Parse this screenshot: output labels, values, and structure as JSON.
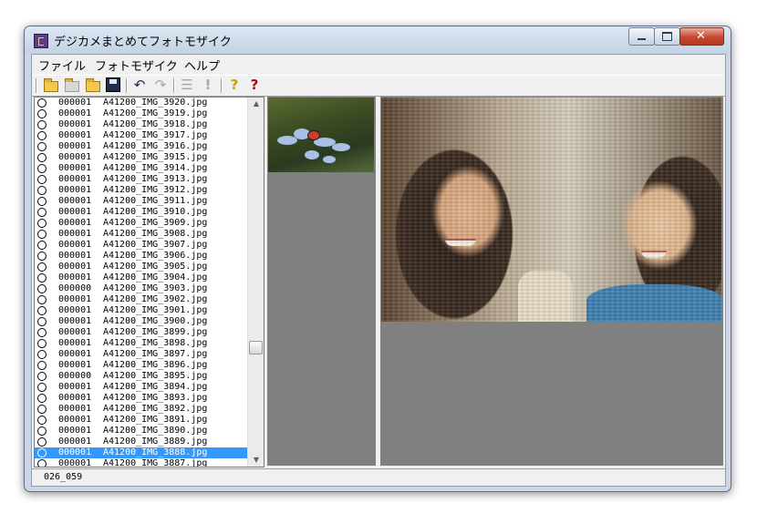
{
  "window": {
    "title": "デジカメまとめてフォトモザイク",
    "controls": [
      "minimize",
      "maximize",
      "close"
    ]
  },
  "menu": [
    {
      "label": "ファイル"
    },
    {
      "label": "フォトモザイク"
    },
    {
      "label": "ヘルプ"
    }
  ],
  "toolbar": {
    "icons": [
      "open-folder-icon",
      "import-icon",
      "folder-icon",
      "save-disk-icon",
      "undo-icon",
      "redo-icon",
      "list-icon",
      "exclamation-icon",
      "help-icon",
      "context-help-icon"
    ]
  },
  "file_list": {
    "rows": [
      {
        "count": "000001",
        "name": "A41200_IMG_3920.jpg"
      },
      {
        "count": "000001",
        "name": "A41200_IMG_3919.jpg"
      },
      {
        "count": "000001",
        "name": "A41200_IMG_3918.jpg"
      },
      {
        "count": "000001",
        "name": "A41200_IMG_3917.jpg"
      },
      {
        "count": "000001",
        "name": "A41200_IMG_3916.jpg"
      },
      {
        "count": "000001",
        "name": "A41200_IMG_3915.jpg"
      },
      {
        "count": "000001",
        "name": "A41200_IMG_3914.jpg"
      },
      {
        "count": "000001",
        "name": "A41200_IMG_3913.jpg"
      },
      {
        "count": "000001",
        "name": "A41200_IMG_3912.jpg"
      },
      {
        "count": "000001",
        "name": "A41200_IMG_3911.jpg"
      },
      {
        "count": "000001",
        "name": "A41200_IMG_3910.jpg"
      },
      {
        "count": "000001",
        "name": "A41200_IMG_3909.jpg"
      },
      {
        "count": "000001",
        "name": "A41200_IMG_3908.jpg"
      },
      {
        "count": "000001",
        "name": "A41200_IMG_3907.jpg"
      },
      {
        "count": "000001",
        "name": "A41200_IMG_3906.jpg"
      },
      {
        "count": "000001",
        "name": "A41200_IMG_3905.jpg"
      },
      {
        "count": "000001",
        "name": "A41200_IMG_3904.jpg"
      },
      {
        "count": "000000",
        "name": "A41200_IMG_3903.jpg"
      },
      {
        "count": "000001",
        "name": "A41200_IMG_3902.jpg"
      },
      {
        "count": "000001",
        "name": "A41200_IMG_3901.jpg"
      },
      {
        "count": "000001",
        "name": "A41200_IMG_3900.jpg"
      },
      {
        "count": "000001",
        "name": "A41200_IMG_3899.jpg"
      },
      {
        "count": "000001",
        "name": "A41200_IMG_3898.jpg"
      },
      {
        "count": "000001",
        "name": "A41200_IMG_3897.jpg"
      },
      {
        "count": "000001",
        "name": "A41200_IMG_3896.jpg"
      },
      {
        "count": "000000",
        "name": "A41200_IMG_3895.jpg"
      },
      {
        "count": "000001",
        "name": "A41200_IMG_3894.jpg"
      },
      {
        "count": "000001",
        "name": "A41200_IMG_3893.jpg"
      },
      {
        "count": "000001",
        "name": "A41200_IMG_3892.jpg"
      },
      {
        "count": "000001",
        "name": "A41200_IMG_3891.jpg"
      },
      {
        "count": "000001",
        "name": "A41200_IMG_3890.jpg"
      },
      {
        "count": "000001",
        "name": "A41200_IMG_3889.jpg"
      },
      {
        "count": "000001",
        "name": "A41200_IMG_3888.jpg",
        "selected": true
      },
      {
        "count": "000001",
        "name": "A41200_IMG_3887.jpg"
      }
    ],
    "scroll_position": 0.7
  },
  "status": {
    "text": "026_059"
  },
  "colors": {
    "selection": "#3399ff",
    "panel_background": "#808080",
    "window_frame": "#cbd7e6"
  }
}
